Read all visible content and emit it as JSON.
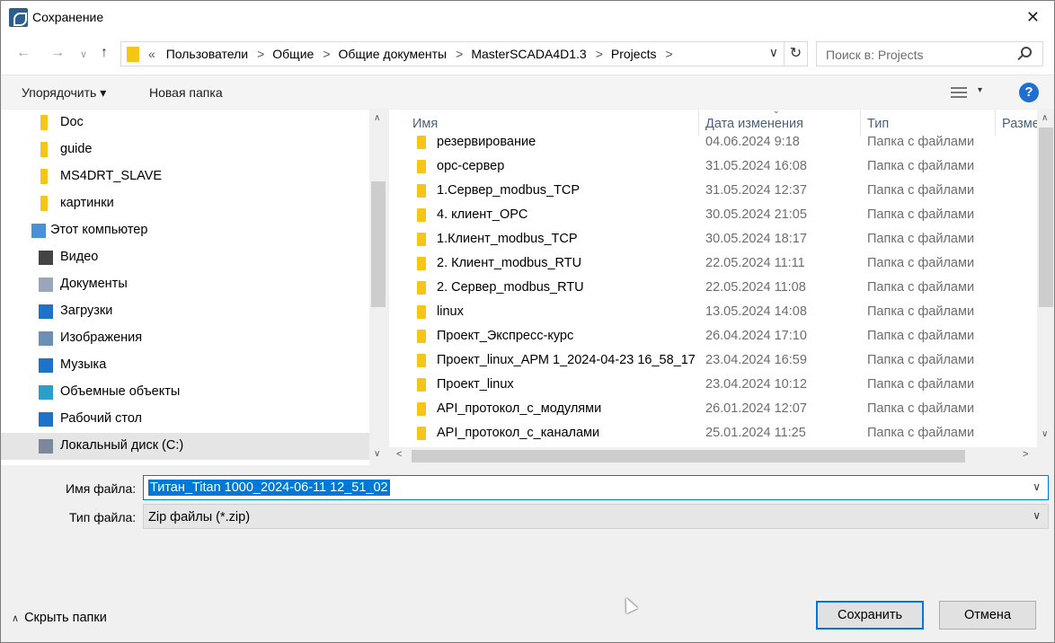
{
  "window": {
    "title": "Сохранение",
    "close_glyph": "✕"
  },
  "nav": {
    "back_glyph": "←",
    "forward_glyph": "→",
    "recent_glyph": "∨",
    "up_glyph": "↑",
    "breadcrumb_overflow": "«",
    "breadcrumbs": [
      "Пользователи",
      "Общие",
      "Общие документы",
      "MasterSCADA4D1.3",
      "Projects"
    ],
    "crumb_separator": ">",
    "search_placeholder": "Поиск в: Projects",
    "refresh_glyph": "↻",
    "dropdown_glyph": "∨"
  },
  "toolbar": {
    "organize_label": "Упорядочить ▾",
    "new_folder_label": "Новая папка",
    "view_chevron": "▾",
    "help_label": "?"
  },
  "tree": {
    "items": [
      {
        "label": "Doc",
        "icon": "folder-icon"
      },
      {
        "label": "guide",
        "icon": "folder-icon"
      },
      {
        "label": "MS4DRT_SLAVE",
        "icon": "folder-icon"
      },
      {
        "label": "картинки",
        "icon": "folder-icon"
      },
      {
        "label": "Этот компьютер",
        "icon": "computer-icon"
      },
      {
        "label": "Видео",
        "icon": "video-icon"
      },
      {
        "label": "Документы",
        "icon": "documents-icon"
      },
      {
        "label": "Загрузки",
        "icon": "downloads-icon"
      },
      {
        "label": "Изображения",
        "icon": "pictures-icon"
      },
      {
        "label": "Музыка",
        "icon": "music-icon"
      },
      {
        "label": "Объемные объекты",
        "icon": "3d-objects-icon"
      },
      {
        "label": "Рабочий стол",
        "icon": "desktop-icon"
      },
      {
        "label": "Локальный диск (C:)",
        "icon": "drive-icon"
      }
    ],
    "selected_index": 12
  },
  "columns": {
    "name": "Имя",
    "date": "Дата изменения",
    "type": "Тип",
    "size": "Разме"
  },
  "files": [
    {
      "name": "резервирование",
      "date": "04.06.2024 9:18",
      "type": "Папка с файлами"
    },
    {
      "name": "opc-сервер",
      "date": "31.05.2024 16:08",
      "type": "Папка с файлами"
    },
    {
      "name": "1.Сервер_modbus_TCP",
      "date": "31.05.2024 12:37",
      "type": "Папка с файлами"
    },
    {
      "name": "4. клиент_OPC",
      "date": "30.05.2024 21:05",
      "type": "Папка с файлами"
    },
    {
      "name": "1.Клиент_modbus_TCP",
      "date": "30.05.2024 18:17",
      "type": "Папка с файлами"
    },
    {
      "name": "2. Клиент_modbus_RTU",
      "date": "22.05.2024 11:11",
      "type": "Папка с файлами"
    },
    {
      "name": "2. Сервер_modbus_RTU",
      "date": "22.05.2024 11:08",
      "type": "Папка с файлами"
    },
    {
      "name": "linux",
      "date": "13.05.2024 14:08",
      "type": "Папка с файлами"
    },
    {
      "name": "Проект_Экспресс-курс",
      "date": "26.04.2024 17:10",
      "type": "Папка с файлами"
    },
    {
      "name": "Проект_linux_АРМ 1_2024-04-23 16_58_17",
      "date": "23.04.2024 16:59",
      "type": "Папка с файлами"
    },
    {
      "name": "Проект_linux",
      "date": "23.04.2024 10:12",
      "type": "Папка с файлами"
    },
    {
      "name": "API_протокол_с_модулями",
      "date": "26.01.2024 12:07",
      "type": "Папка с файлами"
    },
    {
      "name": "API_протокол_с_каналами",
      "date": "25.01.2024 11:25",
      "type": "Папка с файлами"
    }
  ],
  "form": {
    "filename_label": "Имя файла:",
    "filename_value": "Титан_Titan 1000_2024-06-11 12_51_02",
    "filetype_label": "Тип файла:",
    "filetype_value": "Zip файлы (*.zip)",
    "hide_folders_label": "Скрыть папки",
    "hide_folders_caret": "∧",
    "save_label": "Сохранить",
    "cancel_label": "Отмена"
  },
  "scroll_glyphs": {
    "up": "∧",
    "down": "∨",
    "left": "<",
    "right": ">"
  }
}
